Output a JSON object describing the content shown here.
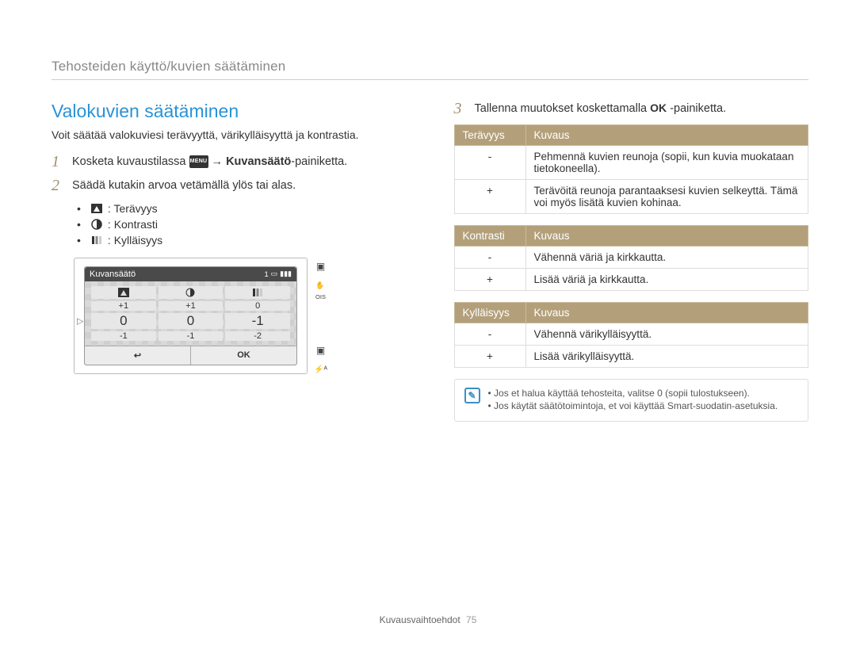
{
  "header": "Tehosteiden käyttö/kuvien säätäminen",
  "left": {
    "title": "Valokuvien säätäminen",
    "intro": "Voit säätää valokuviesi terävyyttä, värikylläisyyttä ja kontrastia.",
    "step1_a": "Kosketa kuvaustilassa ",
    "step1_menu": "MENU",
    "step1_b": " → ",
    "step1_bold": "Kuvansäätö",
    "step1_c": "-painiketta.",
    "step2": "Säädä kutakin arvoa vetämällä ylös tai alas.",
    "bullets": {
      "sharp": "Terävyys",
      "contrast": "Kontrasti",
      "sat": "Kylläisyys"
    },
    "camera": {
      "title": "Kuvansäätö",
      "count": "1",
      "row_up": [
        "+1",
        "+1",
        "0"
      ],
      "row_mid": [
        "0",
        "0",
        "-1"
      ],
      "row_dn": [
        "-1",
        "-1",
        "-2"
      ],
      "ok": "OK"
    }
  },
  "right": {
    "step3_a": "Tallenna muutokset koskettamalla ",
    "step3_ok": "OK",
    "step3_b": " -painiketta.",
    "tables": {
      "sharp": {
        "h1": "Terävyys",
        "h2": "Kuvaus",
        "rows": [
          {
            "sym": "-",
            "txt": "Pehmennä kuvien reunoja (sopii, kun kuvia muokataan tietokoneella)."
          },
          {
            "sym": "+",
            "txt": "Terävöitä reunoja parantaaksesi kuvien selkeyttä. Tämä voi myös lisätä kuvien kohinaa."
          }
        ]
      },
      "contrast": {
        "h1": "Kontrasti",
        "h2": "Kuvaus",
        "rows": [
          {
            "sym": "-",
            "txt": "Vähennä väriä ja kirkkautta."
          },
          {
            "sym": "+",
            "txt": "Lisää väriä ja kirkkautta."
          }
        ]
      },
      "sat": {
        "h1": "Kylläisyys",
        "h2": "Kuvaus",
        "rows": [
          {
            "sym": "-",
            "txt": "Vähennä värikylläisyyttä."
          },
          {
            "sym": "+",
            "txt": "Lisää värikylläisyyttä."
          }
        ]
      }
    },
    "notes": [
      "Jos et halua käyttää tehosteita, valitse 0 (sopii tulostukseen).",
      "Jos käytät säätötoimintoja, et voi käyttää Smart-suodatin-asetuksia."
    ]
  },
  "footer": {
    "section": "Kuvausvaihtoehdot",
    "page": "75"
  }
}
